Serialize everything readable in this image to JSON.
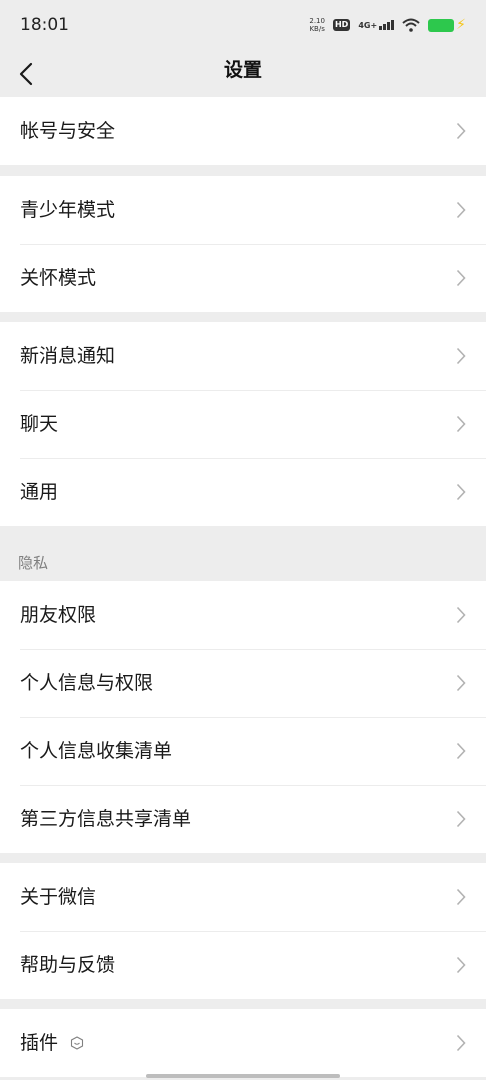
{
  "status_bar": {
    "time": "18:01",
    "speed_value": "2.10",
    "speed_unit": "KB/s",
    "hd": "HD",
    "network": "4G+"
  },
  "header": {
    "title": "设置",
    "back_icon": "chevron-left-icon"
  },
  "groups": [
    {
      "items": [
        {
          "label": "帐号与安全"
        }
      ]
    },
    {
      "items": [
        {
          "label": "青少年模式"
        },
        {
          "label": "关怀模式"
        }
      ]
    },
    {
      "items": [
        {
          "label": "新消息通知"
        },
        {
          "label": "聊天"
        },
        {
          "label": "通用"
        }
      ]
    },
    {
      "section_title": "隐私",
      "items": [
        {
          "label": "朋友权限"
        },
        {
          "label": "个人信息与权限"
        },
        {
          "label": "个人信息收集清单"
        },
        {
          "label": "第三方信息共享清单"
        }
      ]
    },
    {
      "items": [
        {
          "label": "关于微信"
        },
        {
          "label": "帮助与反馈"
        }
      ]
    },
    {
      "items": [
        {
          "label": "插件",
          "icon": "plugin-icon"
        }
      ]
    }
  ],
  "colors": {
    "background": "#EDEDED",
    "row": "#FFFFFF",
    "battery": "#2DC84D",
    "chevron": "#B2B2B2"
  }
}
